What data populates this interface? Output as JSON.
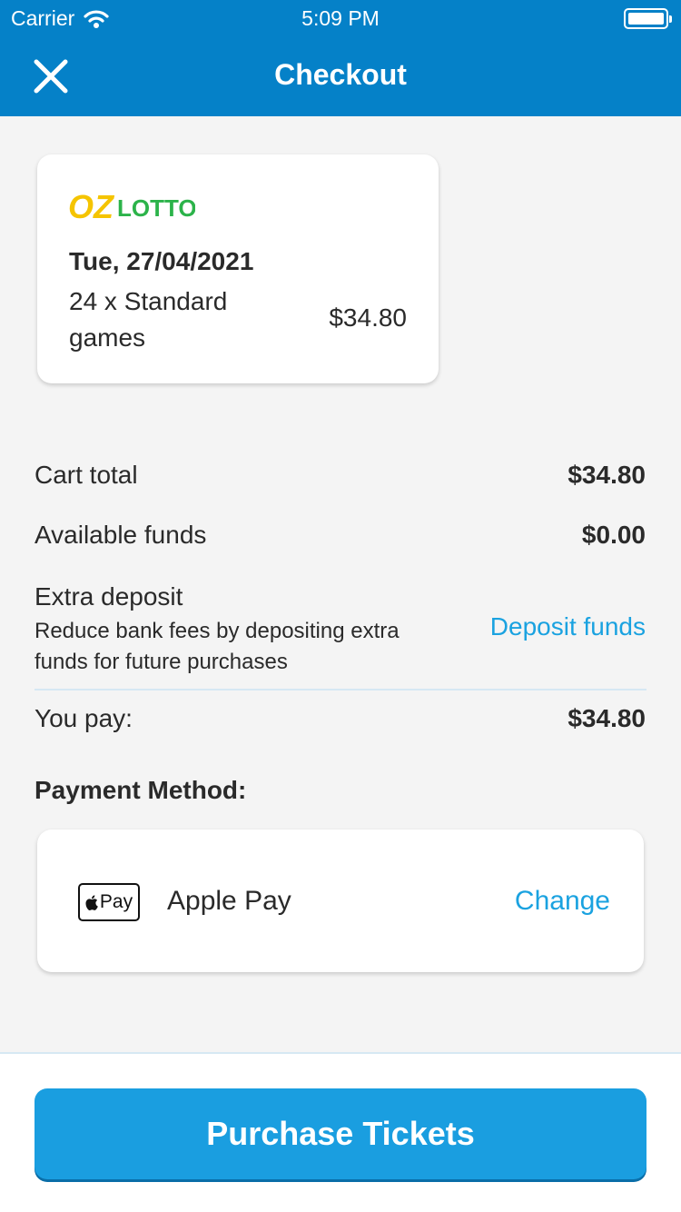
{
  "status_bar": {
    "carrier": "Carrier",
    "time": "5:09 PM"
  },
  "header": {
    "title": "Checkout",
    "close_icon": "close-icon"
  },
  "ticket": {
    "logo": "OZ LOTTO",
    "date": "Tue, 27/04/2021",
    "games": "24 x Standard games",
    "price": "$34.80"
  },
  "summary": {
    "cart_total_label": "Cart total",
    "cart_total_value": "$34.80",
    "available_funds_label": "Available funds",
    "available_funds_value": "$0.00",
    "extra_deposit_label": "Extra deposit",
    "extra_deposit_hint": "Reduce bank fees by depositing extra funds for future purchases",
    "deposit_link": "Deposit funds",
    "you_pay_label": "You pay:",
    "you_pay_value": "$34.80"
  },
  "payment": {
    "section_title": "Payment Method:",
    "badge": "Pay",
    "method": "Apple Pay",
    "change_link": "Change"
  },
  "footer": {
    "purchase_label": "Purchase Tickets"
  },
  "colors": {
    "header": "#0581c8",
    "accent": "#1aa2e0",
    "button": "#1a9ee0",
    "logo_yellow": "#f5c400",
    "logo_green": "#2cb34a"
  }
}
